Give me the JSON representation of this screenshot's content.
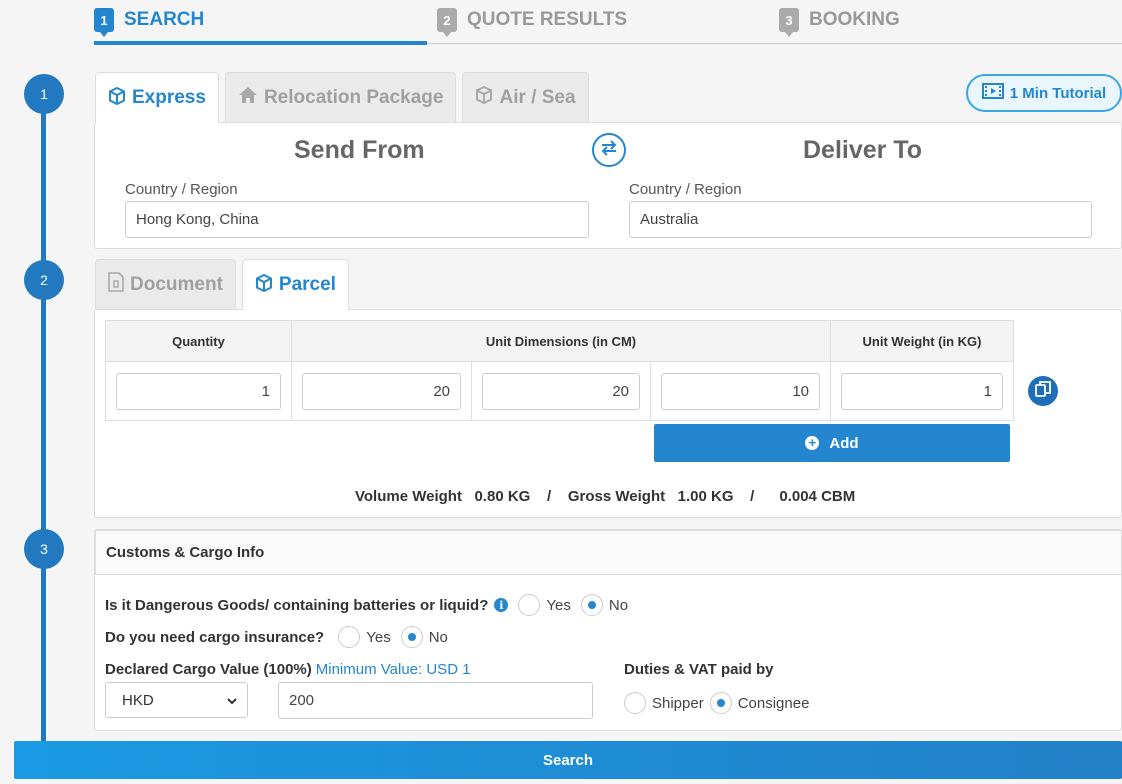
{
  "stepper": {
    "steps": [
      {
        "num": "1",
        "label": "SEARCH"
      },
      {
        "num": "2",
        "label": "QUOTE RESULTS"
      },
      {
        "num": "3",
        "label": "BOOKING"
      }
    ]
  },
  "timeline": {
    "steps": [
      "1",
      "2",
      "3"
    ]
  },
  "service_tabs": [
    {
      "label": "Express",
      "icon": "box-icon"
    },
    {
      "label": "Relocation Package",
      "icon": "house-icon"
    },
    {
      "label": "Air / Sea",
      "icon": "box-icon"
    }
  ],
  "tutorial_label": "1 Min Tutorial",
  "route": {
    "from_title": "Send From",
    "to_title": "Deliver To",
    "from_label": "Country / Region",
    "to_label": "Country / Region",
    "from_value": "Hong Kong, China",
    "to_value": "Australia"
  },
  "package_tabs": [
    {
      "label": "Document",
      "icon": "document-icon"
    },
    {
      "label": "Parcel",
      "icon": "box-icon"
    }
  ],
  "dims": {
    "headers": [
      "Quantity",
      "Unit Dimensions (in CM)",
      "Unit Weight (in KG)"
    ],
    "quantity": "1",
    "length": "20",
    "width": "20",
    "height": "10",
    "weight": "1",
    "add_label": "Add"
  },
  "weights": {
    "volume_label": "Volume Weight",
    "volume_value": "0.80 KG",
    "gross_label": "Gross Weight",
    "gross_value": "1.00 KG",
    "cbm_value": "0.004 CBM",
    "sep": "/"
  },
  "customs": {
    "title": "Customs & Cargo Info",
    "dangerous_q": "Is it Dangerous Goods/ containing batteries or liquid?",
    "insurance_q": "Do you need cargo insurance?",
    "yes": "Yes",
    "no": "No",
    "declared_label": "Declared Cargo Value (100%)",
    "min_value": "Minimum Value: USD 1",
    "currency": "HKD",
    "declared_value": "200",
    "duties_label": "Duties & VAT paid by",
    "shipper": "Shipper",
    "consignee": "Consignee"
  },
  "search_label": "Search",
  "colors": {
    "accent": "#2486cf",
    "timeline": "#2279bf"
  }
}
